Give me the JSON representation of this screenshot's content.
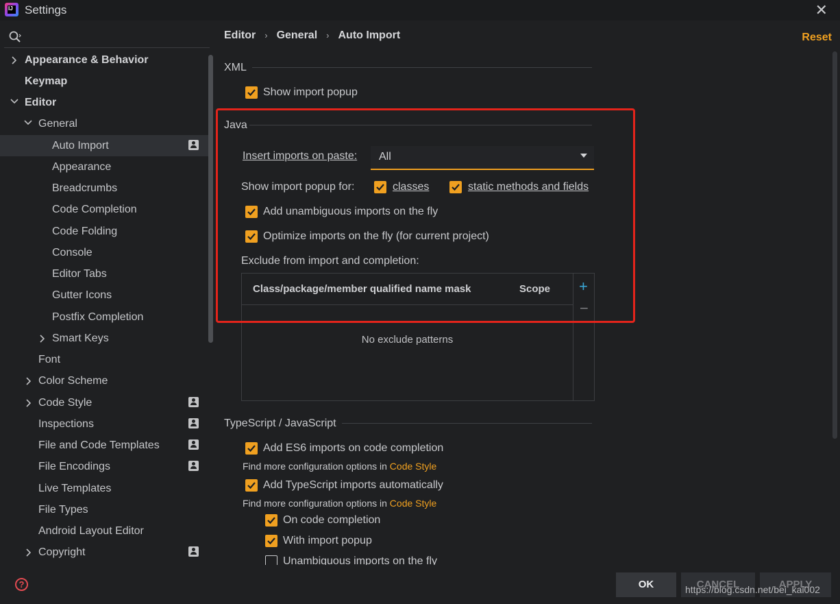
{
  "window": {
    "title": "Settings"
  },
  "search": {
    "placeholder": ""
  },
  "sidebar": {
    "items": [
      {
        "label": "Appearance & Behavior"
      },
      {
        "label": "Keymap"
      },
      {
        "label": "Editor"
      },
      {
        "label": "General"
      },
      {
        "label": "Auto Import"
      },
      {
        "label": "Appearance"
      },
      {
        "label": "Breadcrumbs"
      },
      {
        "label": "Code Completion"
      },
      {
        "label": "Code Folding"
      },
      {
        "label": "Console"
      },
      {
        "label": "Editor Tabs"
      },
      {
        "label": "Gutter Icons"
      },
      {
        "label": "Postfix Completion"
      },
      {
        "label": "Smart Keys"
      },
      {
        "label": "Font"
      },
      {
        "label": "Color Scheme"
      },
      {
        "label": "Code Style"
      },
      {
        "label": "Inspections"
      },
      {
        "label": "File and Code Templates"
      },
      {
        "label": "File Encodings"
      },
      {
        "label": "Live Templates"
      },
      {
        "label": "File Types"
      },
      {
        "label": "Android Layout Editor"
      },
      {
        "label": "Copyright"
      }
    ]
  },
  "breadcrumb": {
    "items": [
      "Editor",
      "General",
      "Auto Import"
    ]
  },
  "header": {
    "reset_label": "Reset"
  },
  "xml": {
    "title": "XML",
    "show_import_popup": {
      "label": "Show import popup",
      "checked": true
    }
  },
  "java": {
    "title": "Java",
    "insert_on_paste": {
      "label": "Insert imports on paste:",
      "value": "All"
    },
    "show_popup_for": {
      "label": "Show import popup for:",
      "classes": {
        "label": "classes",
        "checked": true
      },
      "static": {
        "label": "static methods and fields",
        "checked": true
      }
    },
    "add_unambiguous": {
      "label": "Add unambiguous imports on the fly",
      "checked": true
    },
    "optimize": {
      "label": "Optimize imports on the fly (for current project)",
      "checked": true
    },
    "exclude_label": "Exclude from import and completion:",
    "table": {
      "columns": [
        "Class/package/member qualified name mask",
        "Scope"
      ],
      "empty_text": "No exclude patterns",
      "add_symbol": "+",
      "remove_symbol": "−"
    }
  },
  "ts": {
    "title": "TypeScript / JavaScript",
    "es6": {
      "label": "Add ES6 imports on code completion",
      "checked": true
    },
    "hint1_text": "Find more configuration options in ",
    "hint1_link": "Code Style",
    "ts_auto": {
      "label": "Add TypeScript imports automatically",
      "checked": true
    },
    "hint2_text": "Find more configuration options in ",
    "hint2_link": "Code Style",
    "on_completion": {
      "label": "On code completion",
      "checked": true
    },
    "with_popup": {
      "label": "With import popup",
      "checked": true
    },
    "unambiguous": {
      "label": "Unambiguous imports on the fly",
      "checked": false
    }
  },
  "footer": {
    "help": "?",
    "ok_label": "OK",
    "cancel_label": "CANCEL",
    "apply_label": "APPLY",
    "watermark": "https://blog.csdn.net/bei_kai002"
  },
  "colors": {
    "accent": "#f0a020",
    "background": "#1f2022",
    "highlight": "#e3241b"
  }
}
